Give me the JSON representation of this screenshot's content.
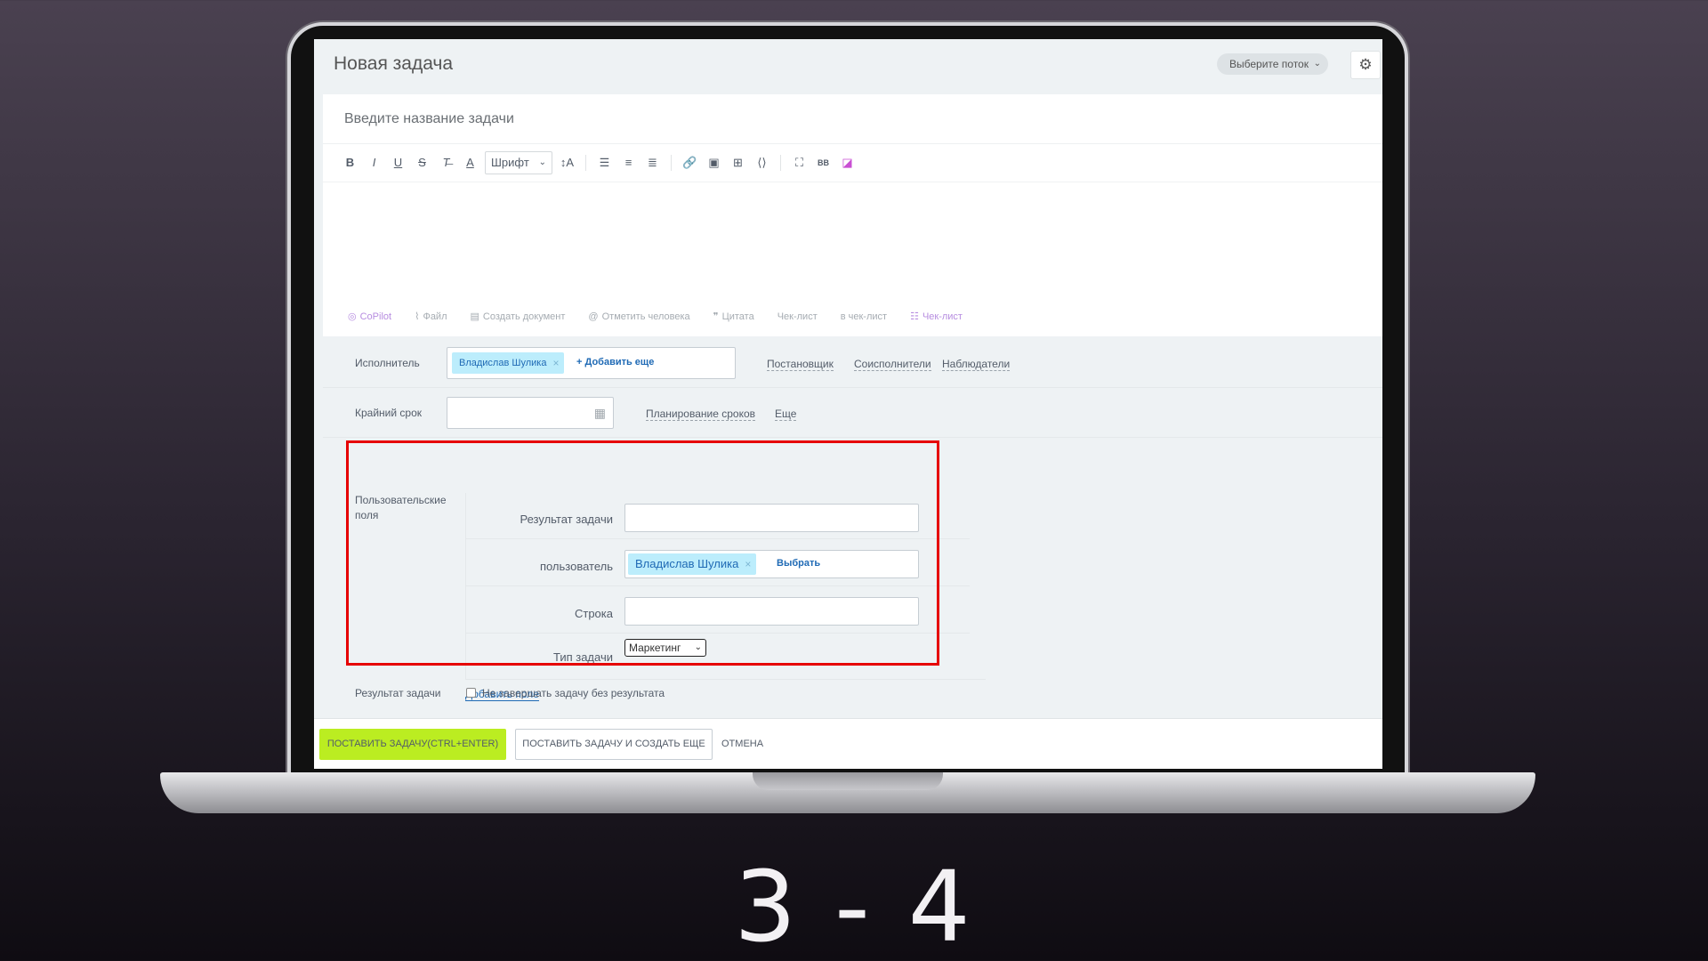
{
  "header": {
    "title": "Новая задача",
    "flow_select": "Выберите поток"
  },
  "editor": {
    "task_name_placeholder": "Введите название задачи",
    "font_select": "Шрифт"
  },
  "attach_bar": {
    "copilot": "CoPilot",
    "file": "Файл",
    "create_doc": "Создать документ",
    "mention": "Отметить человека",
    "quote": "Цитата",
    "checklist": "Чек-лист",
    "to_checklist": "в чек-лист",
    "checklist2": "Чек-лист"
  },
  "assignee_row": {
    "label": "Исполнитель",
    "chip": "Владислав Шулика",
    "add_more": "+ Добавить еще",
    "roles": [
      "Постановщик",
      "Соисполнители",
      "Наблюдатели"
    ]
  },
  "deadline_row": {
    "label": "Крайний срок",
    "planning": "Планирование сроков",
    "more": "Еще"
  },
  "user_fields": {
    "label": "Пользовательские поля",
    "field_result": "Результат задачи",
    "field_user": "пользователь",
    "user_chip": "Владислав Шулика",
    "select_btn": "Выбрать",
    "field_string": "Строка",
    "field_type": "Тип задачи",
    "type_value": "Маркетинг",
    "add_field": "Добавить поле"
  },
  "result_row": {
    "label": "Результат задачи",
    "checkbox_label": "Не завершать задачу без результата"
  },
  "footer": {
    "primary": "ПОСТАВИТЬ ЗАДАЧУ(CTRL+ENTER)",
    "secondary": "ПОСТАВИТЬ ЗАДАЧУ И СОЗДАТЬ ЕЩЕ",
    "cancel": "ОТМЕНА"
  },
  "slide": {
    "number": "3 - 4"
  },
  "colors": {
    "highlight": "#e60000",
    "primary_button": "#bbed21",
    "chip_bg": "#bcedfc",
    "link": "#1f6ab5"
  }
}
